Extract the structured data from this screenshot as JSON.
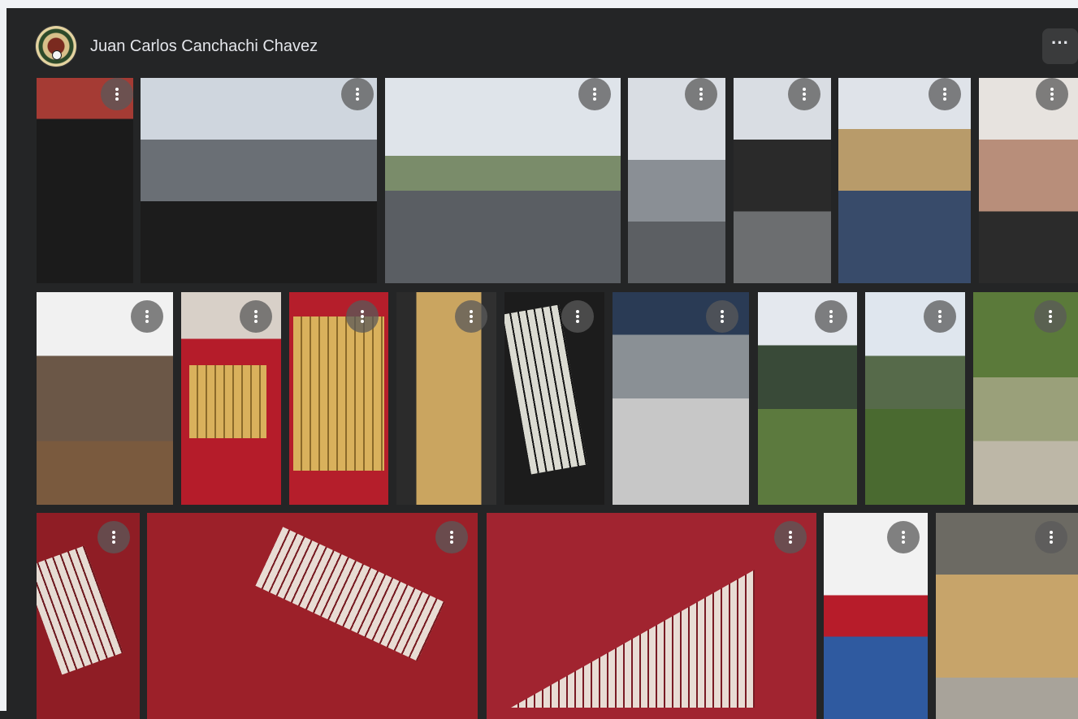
{
  "profile": {
    "name": "Juan Carlos Canchachi Chavez",
    "more_label": "···"
  },
  "photos": [
    {
      "id": "p1",
      "menu": "⋮"
    },
    {
      "id": "p2",
      "menu": "⋮"
    },
    {
      "id": "p3",
      "menu": "⋮"
    },
    {
      "id": "p4",
      "menu": "⋮"
    },
    {
      "id": "p5",
      "menu": "⋮"
    },
    {
      "id": "p6",
      "menu": "⋮"
    },
    {
      "id": "p7",
      "menu": "⋮"
    },
    {
      "id": "p8",
      "menu": "⋮"
    },
    {
      "id": "p9",
      "menu": "⋮"
    },
    {
      "id": "p10",
      "menu": "⋮"
    },
    {
      "id": "p11",
      "menu": "⋮"
    },
    {
      "id": "p12",
      "menu": "⋮"
    },
    {
      "id": "p13",
      "menu": "⋮"
    },
    {
      "id": "p14",
      "menu": "⋮"
    },
    {
      "id": "p15",
      "menu": "⋮"
    },
    {
      "id": "p16",
      "menu": "⋮"
    },
    {
      "id": "p17",
      "menu": "⋮"
    },
    {
      "id": "p18",
      "menu": "⋮"
    },
    {
      "id": "p19",
      "menu": "⋮"
    },
    {
      "id": "p20",
      "menu": "⋮"
    },
    {
      "id": "p21",
      "menu": "⋮"
    }
  ],
  "icons": {
    "avatar": "profile-avatar",
    "menu": "more-vertical-icon",
    "header_menu": "more-horizontal-icon"
  }
}
